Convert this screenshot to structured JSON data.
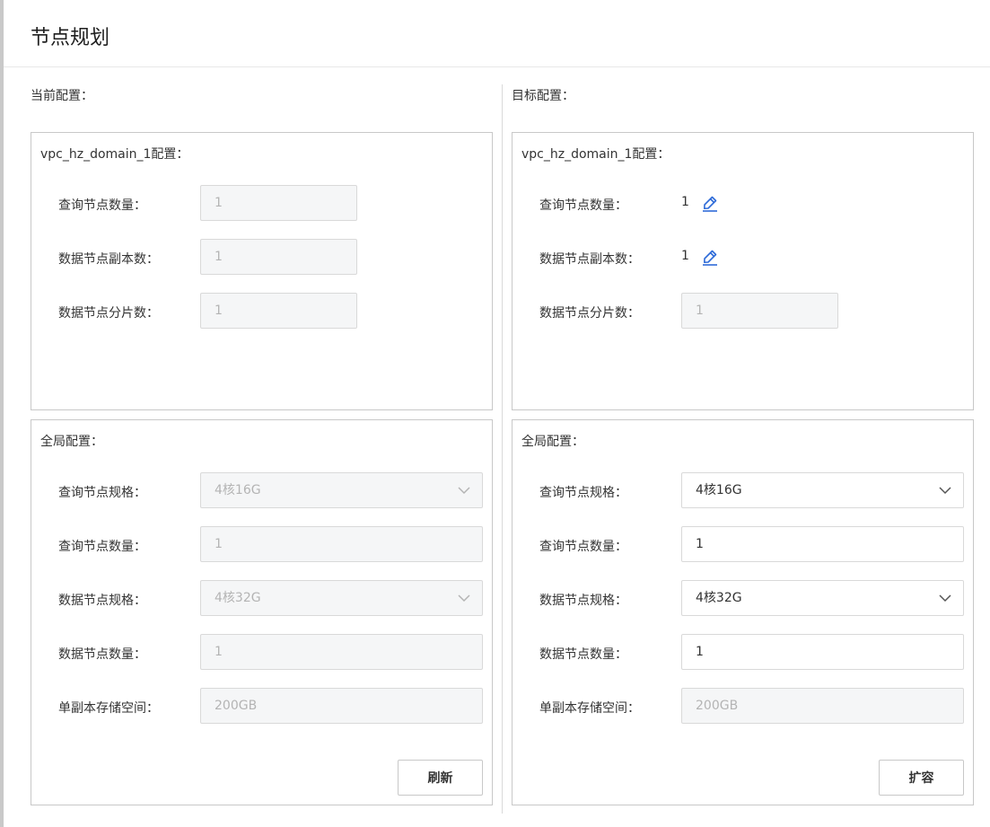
{
  "dialog": {
    "title": "节点规划"
  },
  "current": {
    "title": "当前配置：",
    "domain": {
      "title": "vpc_hz_domain_1配置：",
      "rows": [
        {
          "label": "查询节点数量：",
          "value": "1"
        },
        {
          "label": "数据节点副本数：",
          "value": "1"
        },
        {
          "label": "数据节点分片数：",
          "value": "1"
        }
      ]
    },
    "global": {
      "title": "全局配置：",
      "query_spec": {
        "label": "查询节点规格：",
        "value": "4核16G"
      },
      "query_count": {
        "label": "查询节点数量：",
        "value": "1"
      },
      "data_spec": {
        "label": "数据节点规格：",
        "value": "4核32G"
      },
      "data_count": {
        "label": "数据节点数量：",
        "value": "1"
      },
      "storage": {
        "label": "单副本存储空间：",
        "value": "200GB"
      }
    },
    "button_label": "刷新"
  },
  "target": {
    "title": "目标配置：",
    "domain": {
      "title": "vpc_hz_domain_1配置：",
      "query_count": {
        "label": "查询节点数量：",
        "value": "1",
        "icon": "edit-icon"
      },
      "replicas": {
        "label": "数据节点副本数：",
        "value": "1",
        "icon": "edit-icon"
      },
      "shards": {
        "label": "数据节点分片数：",
        "value": "1"
      }
    },
    "global": {
      "title": "全局配置：",
      "query_spec": {
        "label": "查询节点规格：",
        "value": "4核16G"
      },
      "query_count": {
        "label": "查询节点数量：",
        "value": "1"
      },
      "data_spec": {
        "label": "数据节点规格：",
        "value": "4核32G"
      },
      "data_count": {
        "label": "数据节点数量：",
        "value": "1"
      },
      "storage": {
        "label": "单副本存储空间：",
        "value": "200GB"
      }
    },
    "button_label": "扩容"
  },
  "colors": {
    "accent": "#2e6bd8",
    "border": "#c8c8c8",
    "disabled_bg": "#f5f6f7",
    "disabled_text": "#b4b4b4"
  }
}
